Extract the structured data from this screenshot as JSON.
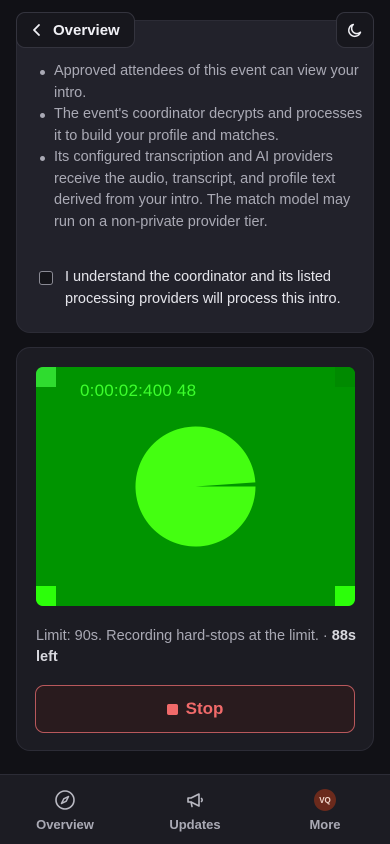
{
  "header": {
    "back_label": "Overview",
    "theme_icon": "moon-icon"
  },
  "consent": {
    "items": [
      "Approved attendees of this event can view your intro.",
      "The event's coordinator decrypts and processes it to build your profile and matches.",
      "Its configured transcription and AI providers receive the audio, transcript, and profile text derived from your intro. The match model may run on a non-private provider tier."
    ],
    "checkbox_label": "I understand the coordinator and its listed processing providers will process this intro.",
    "checked": false
  },
  "recorder": {
    "timecode": "0:00:02:400 48",
    "progress_fraction": 0.011,
    "limit_text": "Limit: 90s. Recording hard-stops at the limit. ·",
    "time_left": "88s left",
    "stop_label": "Stop",
    "colors": {
      "preview_bg": "#009400",
      "indicator": "#44ff11",
      "stop_accent": "#f06a6a"
    }
  },
  "bottom_nav": {
    "items": [
      {
        "label": "Overview",
        "icon": "compass-icon"
      },
      {
        "label": "Updates",
        "icon": "megaphone-icon"
      },
      {
        "label": "More",
        "icon": "avatar",
        "avatar_initials": "VQ"
      }
    ]
  }
}
